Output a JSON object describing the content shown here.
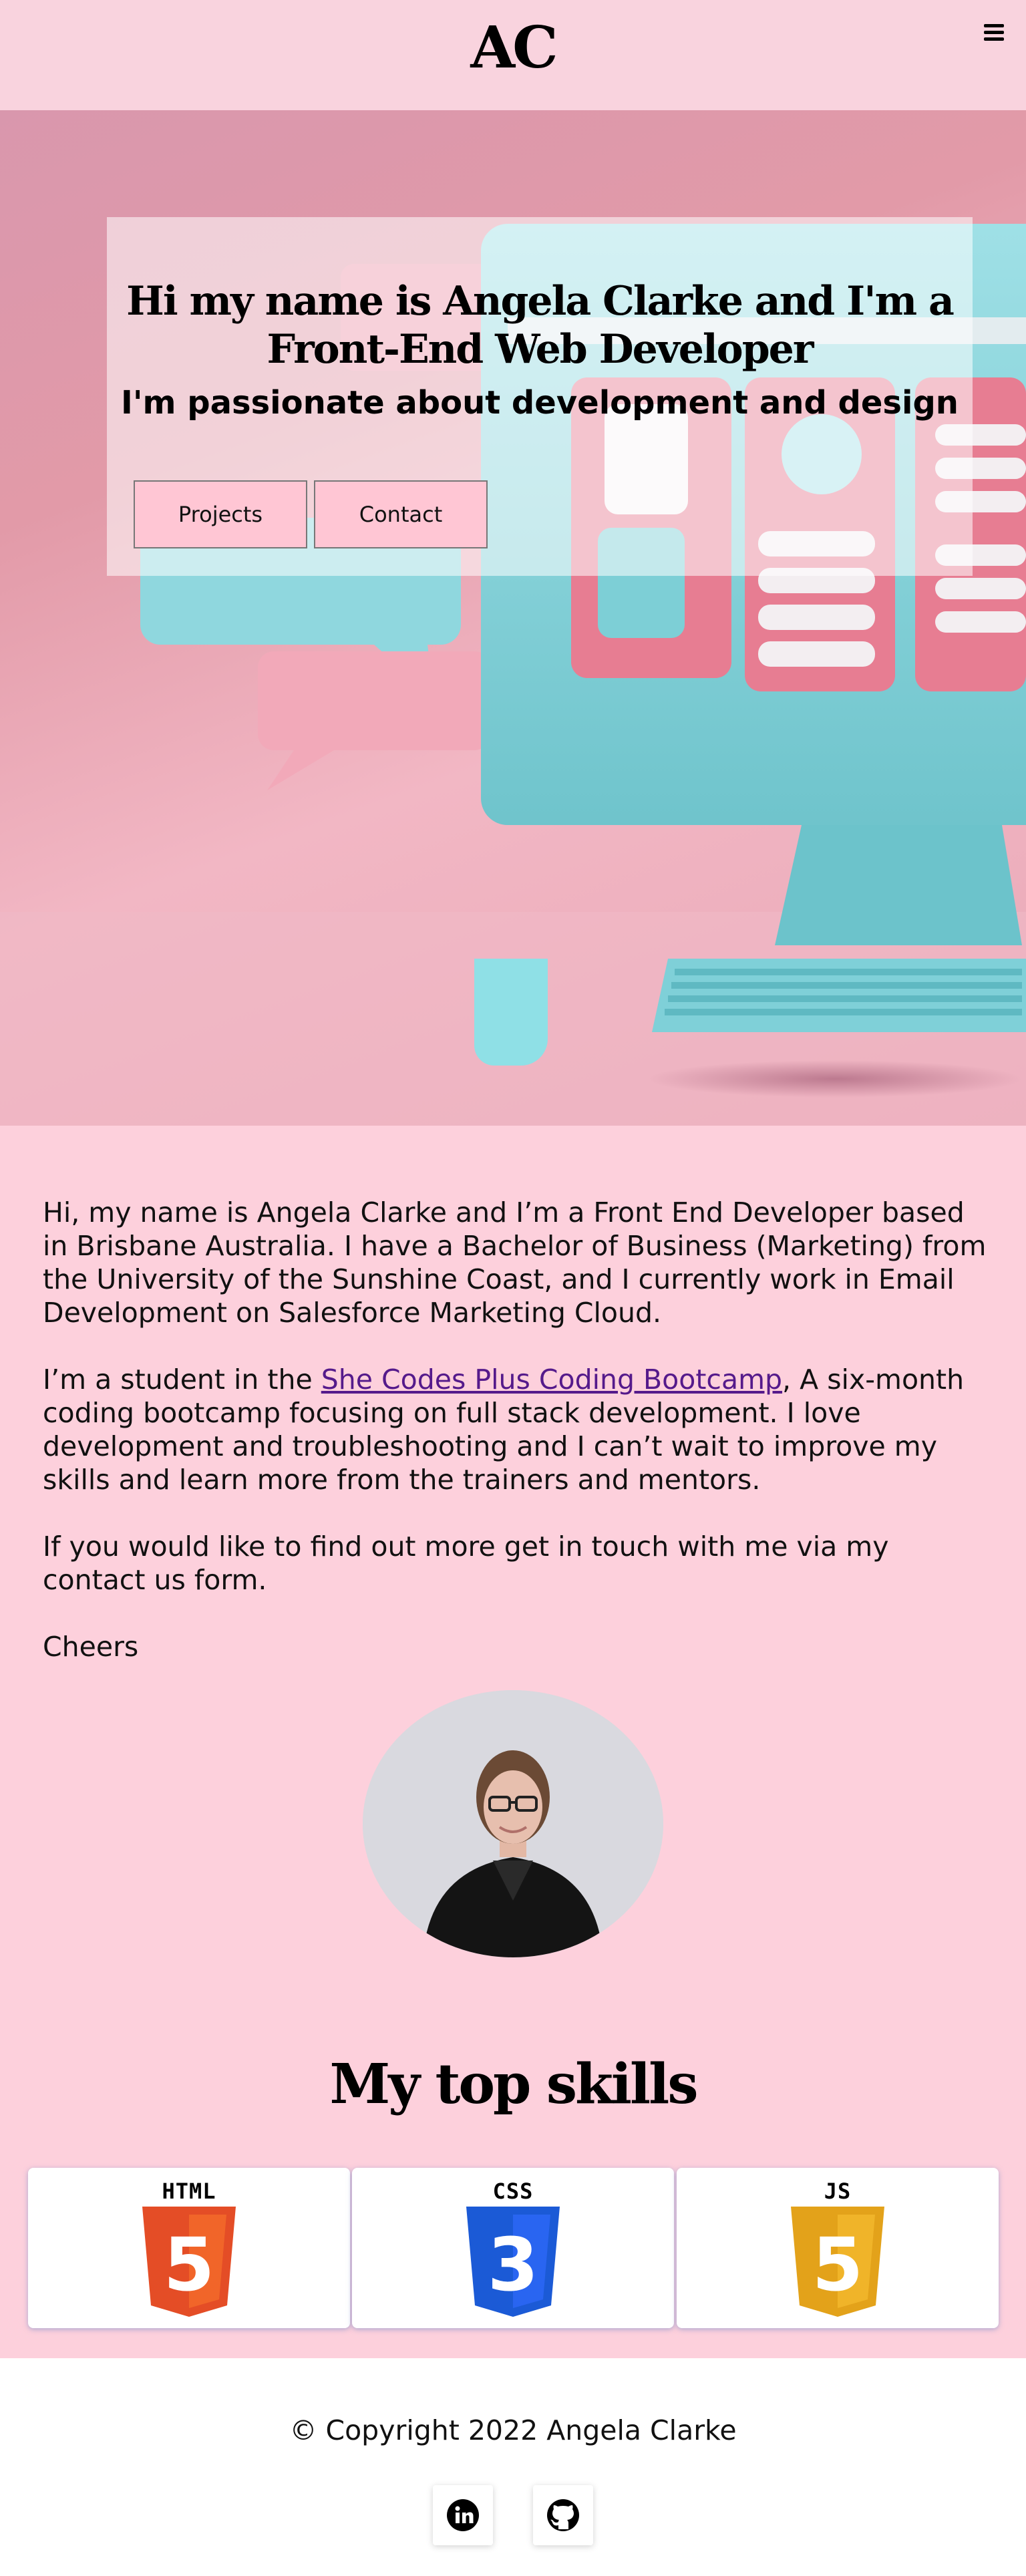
{
  "header": {
    "logo": "AC",
    "menu_icon": "hamburger-menu-icon"
  },
  "hero": {
    "title": "Hi my name is Angela Clarke and I'm a Front-End Web Developer",
    "subtitle": "I'm passionate about development and design",
    "buttons": {
      "projects": "Projects",
      "contact": "Contact"
    }
  },
  "about": {
    "p1": "Hi, my name is Angela Clarke and I’m a Front End Developer based in Brisbane Australia. I have a Bachelor of Business (Marketing) from the University of the Sunshine Coast, and I currently work in Email Development on Salesforce Marketing Cloud.",
    "p2_before": "I’m a student in the ",
    "p2_link": "She Codes Plus Coding Bootcamp",
    "p2_after": ", A six-month coding bootcamp focusing on full stack development. I love development and troubleshooting and I can’t wait to improve my skills and learn more from the trainers and mentors.",
    "p3": "If you would like to find out more get in touch with me via my contact us form.",
    "p4": "Cheers"
  },
  "skills": {
    "title": "My top skills",
    "items": [
      {
        "label": "HTML",
        "digit": "5",
        "icon": "html5-icon",
        "color": "#e44d26",
        "shade": "#f16529"
      },
      {
        "label": "CSS",
        "digit": "3",
        "icon": "css3-icon",
        "color": "#1b5ad6",
        "shade": "#2965f1"
      },
      {
        "label": "JS",
        "digit": "5",
        "icon": "js-icon",
        "color": "#e3a21a",
        "shade": "#f0b429"
      }
    ]
  },
  "footer": {
    "copyright": "© Copyright 2022 Angela Clarke",
    "social": [
      {
        "icon": "linkedin-icon"
      },
      {
        "icon": "github-icon"
      }
    ]
  },
  "colors": {
    "page_background": "#fdd0dc",
    "header_background": "#f9d3de",
    "button_background": "#ffc6d4",
    "link": "#551a8b"
  }
}
